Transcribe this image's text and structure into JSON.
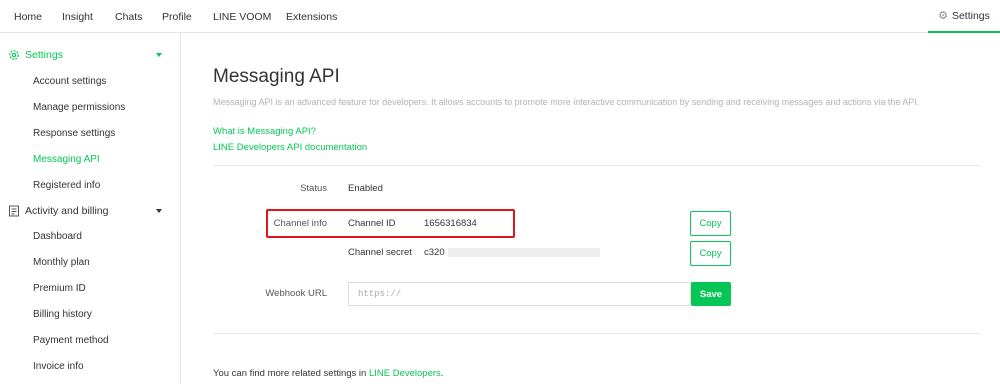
{
  "nav": {
    "items": [
      {
        "label": "Home"
      },
      {
        "label": "Insight"
      },
      {
        "label": "Chats"
      },
      {
        "label": "Profile"
      },
      {
        "label": "LINE VOOM"
      },
      {
        "label": "Extensions"
      }
    ],
    "settings_label": "Settings"
  },
  "sidebar": {
    "settings_section": {
      "label": "Settings",
      "items": [
        {
          "label": "Account settings"
        },
        {
          "label": "Manage permissions"
        },
        {
          "label": "Response settings"
        },
        {
          "label": "Messaging API",
          "active": true
        },
        {
          "label": "Registered info"
        }
      ]
    },
    "billing_section": {
      "label": "Activity and billing",
      "items": [
        {
          "label": "Dashboard"
        },
        {
          "label": "Monthly plan"
        },
        {
          "label": "Premium ID"
        },
        {
          "label": "Billing history"
        },
        {
          "label": "Payment method"
        },
        {
          "label": "Invoice info"
        }
      ]
    }
  },
  "main": {
    "title": "Messaging API",
    "description": "Messaging API is an advanced feature for developers. It allows accounts to promote more interactive communication by sending and receiving messages and actions via the API.",
    "links": {
      "what_is": "What is Messaging API?",
      "docs": "LINE Developers API documentation"
    },
    "status": {
      "label": "Status",
      "value": "Enabled"
    },
    "channel_info": {
      "label": "Channel info",
      "id_label": "Channel ID",
      "id_value": "1656316834",
      "secret_label": "Channel secret",
      "secret_value": "c320",
      "copy_label": "Copy"
    },
    "webhook": {
      "label": "Webhook URL",
      "placeholder": "https://",
      "save_label": "Save"
    },
    "footer": {
      "text": "You can find more related settings in ",
      "link": "LINE Developers",
      "end": "."
    }
  },
  "colors": {
    "accent": "#06c755",
    "highlight": "#e0141e"
  }
}
